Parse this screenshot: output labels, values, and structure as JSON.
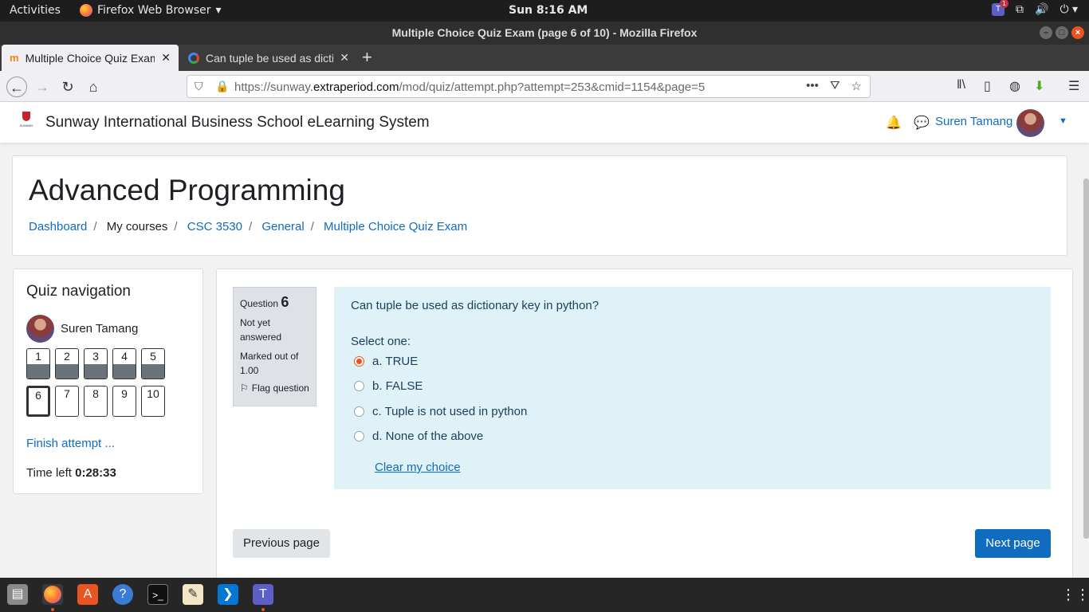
{
  "topbar": {
    "activities": "Activities",
    "app_menu": "Firefox Web Browser",
    "clock": "Sun  8:16 AM",
    "teams_badge": "1"
  },
  "window": {
    "title": "Multiple Choice Quiz Exam (page 6 of 10) - Mozilla Firefox"
  },
  "tabs": [
    {
      "label": "Multiple Choice Quiz Exam",
      "active": true
    },
    {
      "label": "Can tuple be used as dictionary key in python",
      "active": false
    }
  ],
  "url": {
    "prefix": "https://sunway.",
    "domain": "extraperiod.com",
    "path": "/mod/quiz/attempt.php?attempt=253&cmid=1154&page=5"
  },
  "site": {
    "name": "Sunway International Business School eLearning System",
    "logo_text": "SUNWAY",
    "user": "Suren Tamang"
  },
  "course": {
    "title": "Advanced Programming",
    "breadcrumb": [
      "Dashboard",
      "My courses",
      "CSC 3530",
      "General",
      "Multiple Choice Quiz Exam"
    ]
  },
  "quiz_nav": {
    "title": "Quiz navigation",
    "user": "Suren Tamang",
    "buttons": [
      "1",
      "2",
      "3",
      "4",
      "5",
      "6",
      "7",
      "8",
      "9",
      "10"
    ],
    "answered": [
      true,
      true,
      true,
      true,
      true,
      false,
      false,
      false,
      false,
      false
    ],
    "current": "6",
    "finish_label": "Finish attempt ...",
    "time_label": "Time left",
    "time_value": "0:28:33"
  },
  "question": {
    "label": "Question",
    "number": "6",
    "status": "Not yet answered",
    "marks": "Marked out of 1.00",
    "flag": "Flag question",
    "text": "Can tuple be used as dictionary key in python?",
    "prompt": "Select one:",
    "answers": [
      {
        "label": "a. TRUE",
        "checked": true
      },
      {
        "label": "b. FALSE",
        "checked": false
      },
      {
        "label": "c. Tuple is not used in python",
        "checked": false
      },
      {
        "label": "d. None of the above",
        "checked": false
      }
    ],
    "clear_label": "Clear my choice"
  },
  "navigation": {
    "previous": "Previous page",
    "next": "Next page"
  },
  "colors": {
    "accent": "#0f6cbf",
    "question_bg": "#def2f8",
    "radio_checked": "#e95420"
  }
}
